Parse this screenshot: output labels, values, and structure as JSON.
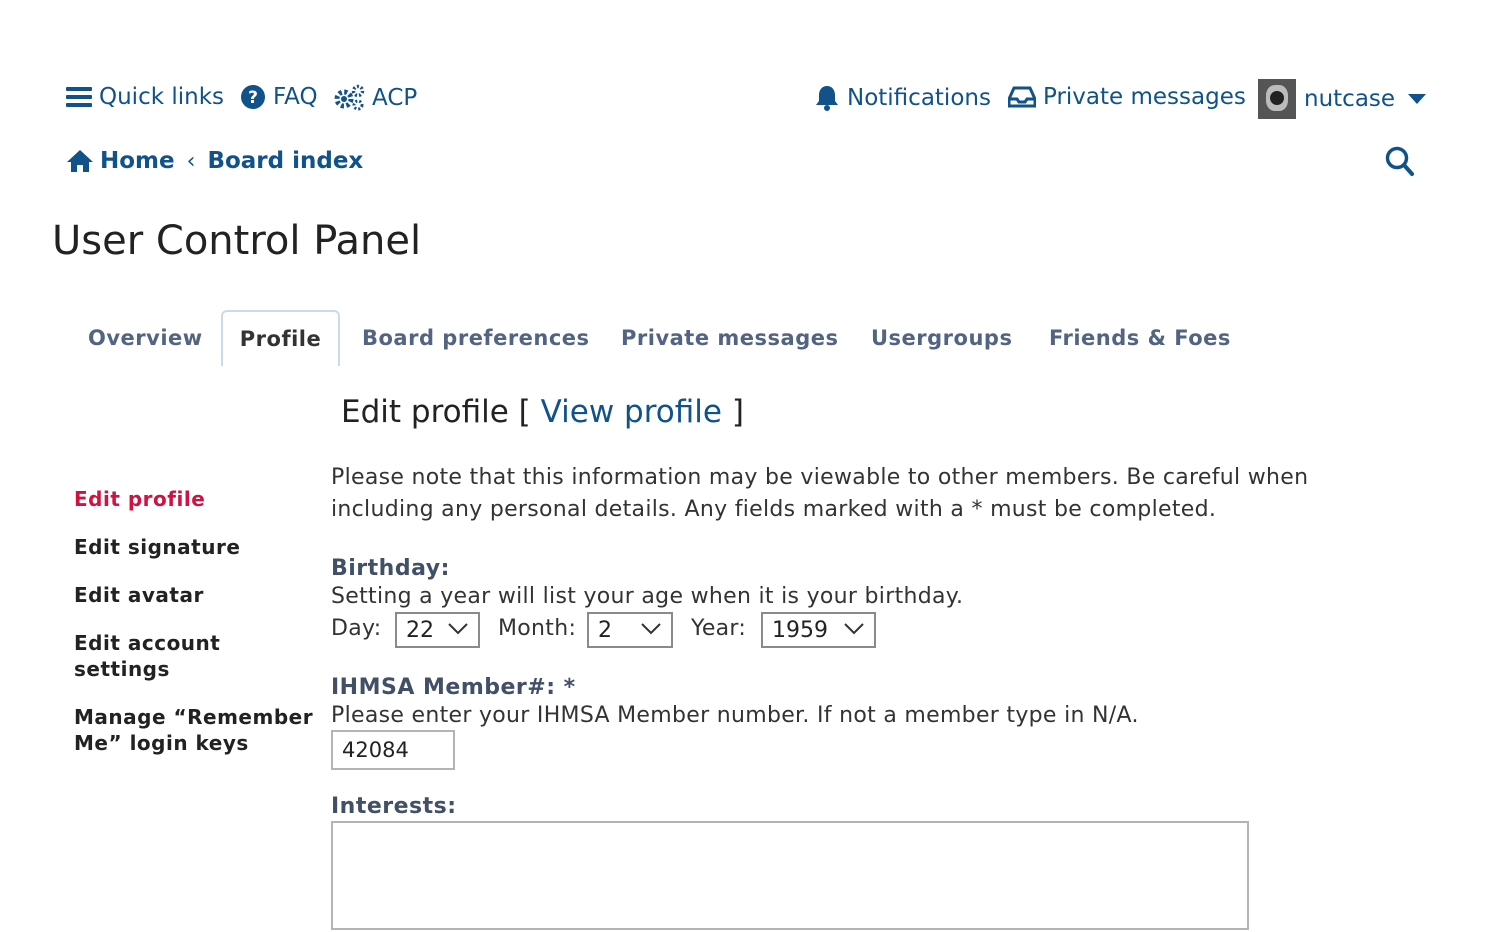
{
  "topbar": {
    "quick_links": "Quick links",
    "faq": "FAQ",
    "acp": "ACP",
    "notifications": "Notifications",
    "private_messages": "Private messages",
    "username": "nutcase"
  },
  "breadcrumb": {
    "home": "Home",
    "separator": "‹",
    "board_index": "Board index"
  },
  "page_title": "User Control Panel",
  "tabs": [
    {
      "label": "Overview"
    },
    {
      "label": "Profile"
    },
    {
      "label": "Board preferences"
    },
    {
      "label": "Private messages"
    },
    {
      "label": "Usergroups"
    },
    {
      "label": "Friends & Foes"
    }
  ],
  "sidebar": {
    "items": [
      {
        "label": "Edit profile"
      },
      {
        "label": "Edit signature"
      },
      {
        "label": "Edit avatar"
      },
      {
        "label": "Edit account settings"
      },
      {
        "label": "Manage “Remember Me” login keys"
      }
    ]
  },
  "main": {
    "heading": "Edit profile",
    "bracket_open": "[",
    "view_profile": "View profile",
    "bracket_close": "]",
    "notice": "Please note that this information may be viewable to other members. Be careful when including any personal details. Any fields marked with a * must be completed.",
    "birthday": {
      "label": "Birthday:",
      "explain": "Setting a year will list your age when it is your birthday.",
      "day_label": "Day:",
      "day_value": "22",
      "month_label": "Month:",
      "month_value": "2",
      "year_label": "Year:",
      "year_value": "1959"
    },
    "member": {
      "label": "IHMSA Member#: *",
      "explain": "Please enter your IHMSA Member number. If not a member type in N/A.",
      "value": "42084"
    },
    "interests": {
      "label": "Interests:",
      "value": ""
    }
  },
  "colors": {
    "link": "#105289",
    "active_side": "#d31141",
    "tab_text": "#536482",
    "label": "#425067"
  }
}
